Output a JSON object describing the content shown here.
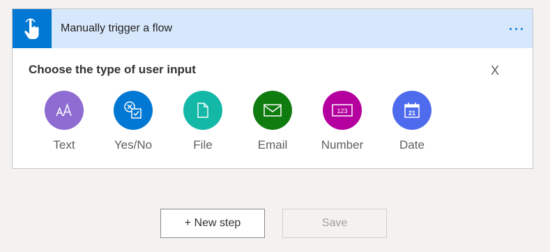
{
  "trigger_card": {
    "title": "Manually trigger a flow",
    "trigger_icon": "touch-hand-icon",
    "more_icon": "more-options-icon",
    "colors": {
      "header_bg": "#d8e8fc",
      "icon_bg": "#0078d4"
    }
  },
  "input_picker": {
    "title": "Choose the type of user input",
    "close_label": "X",
    "types": [
      {
        "label": "Text",
        "icon": "text-icon",
        "color": "#8e6cd1"
      },
      {
        "label": "Yes/No",
        "icon": "yes-no-icon",
        "color": "#0078d4"
      },
      {
        "label": "File",
        "icon": "file-icon",
        "color": "#14b8a6"
      },
      {
        "label": "Email",
        "icon": "email-icon",
        "color": "#107c10"
      },
      {
        "label": "Number",
        "icon": "number-icon",
        "color": "#b4009e"
      },
      {
        "label": "Date",
        "icon": "calendar-icon",
        "color": "#4f6bed"
      }
    ]
  },
  "actions": {
    "new_step_label": "+ New step",
    "save_label": "Save"
  }
}
